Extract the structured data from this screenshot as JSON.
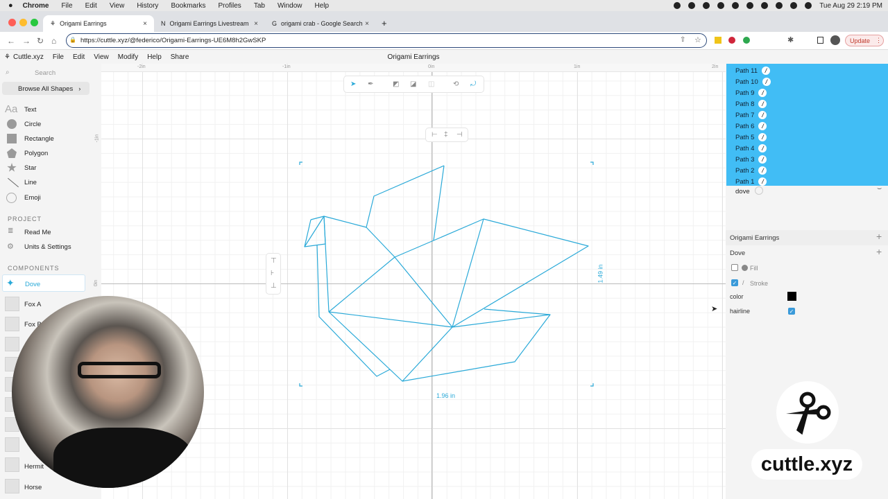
{
  "os_menubar": {
    "app": "Chrome",
    "items": [
      "File",
      "Edit",
      "View",
      "History",
      "Bookmarks",
      "Profiles",
      "Tab",
      "Window",
      "Help"
    ],
    "clock": "Tue Aug 29  2:19 PM"
  },
  "browser": {
    "tabs": [
      {
        "label": "Origami Earrings",
        "active": true
      },
      {
        "label": "Origami Earrings Livestream"
      },
      {
        "label": "origami crab - Google Search"
      }
    ],
    "url": "https://cuttle.xyz/@federico/Origami-Earrings-UE6M8h2GwSKP",
    "update_label": "Update"
  },
  "app": {
    "name": "Cuttle.xyz",
    "menu": [
      "File",
      "Edit",
      "View",
      "Modify",
      "Help",
      "Share"
    ],
    "doc_title": "Origami Earrings"
  },
  "sidebar": {
    "search_placeholder": "Search",
    "browse": "Browse All Shapes",
    "shapes": [
      "Text",
      "Circle",
      "Rectangle",
      "Polygon",
      "Star",
      "Line",
      "Emoji"
    ],
    "text_icon": "Aa",
    "project_heading": "PROJECT",
    "project_items": [
      "Read Me",
      "Units & Settings"
    ],
    "components_heading": "COMPONENTS",
    "components": [
      "Dove",
      "Fox A",
      "Fox B",
      "Hermit",
      "Horse"
    ]
  },
  "rulers": {
    "top": [
      "-2in",
      "-1in",
      "0in",
      "1in",
      "2in"
    ],
    "left": [
      "-1in",
      "0in"
    ]
  },
  "selection": {
    "width_label": "1.96 in",
    "height_label": "1.49 in",
    "stroke_color": "#29a9d8"
  },
  "layers": {
    "paths": [
      "Path 11",
      "Path 10",
      "Path 9",
      "Path 8",
      "Path 7",
      "Path 6",
      "Path 5",
      "Path 4",
      "Path 3",
      "Path 2",
      "Path 1"
    ],
    "group": "dove",
    "selected_color": "#41bdf5"
  },
  "inspector": {
    "project": "Origami Earrings",
    "component": "Dove",
    "fill_label": "Fill",
    "fill_checked": false,
    "stroke_label": "Stroke",
    "stroke_checked": true,
    "color_label": "color",
    "color_value": "#000000",
    "hairline_label": "hairline",
    "hairline_checked": true
  },
  "watermark": {
    "text": "cuttle.xyz"
  }
}
